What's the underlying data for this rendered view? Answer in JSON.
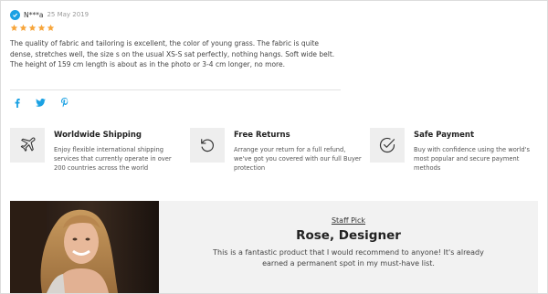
{
  "review": {
    "reviewer": "N***a",
    "date": "25 May 2019",
    "rating": 5,
    "text": "The quality of fabric and tailoring is excellent, the color of young grass. The fabric is quite dense, stretches well, the size s on the usual XS-S sat perfectly, nothing hangs. Soft wide belt. The height of 159 cm length is about as in the photo or 3-4 cm longer, no more.",
    "star_color": "#f7a53b",
    "verified_color": "#1aa1e3"
  },
  "share": [
    "facebook-icon",
    "twitter-icon",
    "pinterest-icon"
  ],
  "share_color": "#1aa1e3",
  "features": [
    {
      "icon": "airplane-icon",
      "title": "Worldwide Shipping",
      "desc": "Enjoy flexible international shipping services that currently operate in over 200 countries across the world"
    },
    {
      "icon": "return-arrow-icon",
      "title": "Free Returns",
      "desc": "Arrange your return for a full refund, we've got you covered with our full Buyer protection"
    },
    {
      "icon": "check-circle-icon",
      "title": "Safe Payment",
      "desc": "Buy with confidence using the world's most popular and secure payment methods"
    }
  ],
  "staff_pick": {
    "label": "Staff Pick",
    "name": "Rose, Designer",
    "quote": "This is a fantastic product that I would recommend to anyone! It's already earned a permanent spot in my must-have list."
  }
}
